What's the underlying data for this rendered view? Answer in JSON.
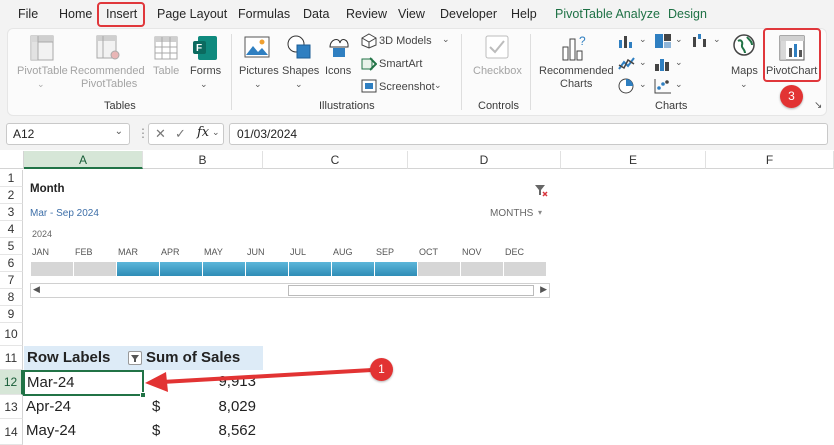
{
  "menu": {
    "tabs": [
      "File",
      "Home",
      "Insert",
      "Page Layout",
      "Formulas",
      "Data",
      "Review",
      "View",
      "Developer",
      "Help",
      "PivotTable Analyze",
      "Design"
    ]
  },
  "ribbon": {
    "tables": {
      "pivottable": "PivotTable",
      "recommended_pivot_1": "Recommended",
      "recommended_pivot_2": "PivotTables",
      "table": "Table",
      "forms": "Forms",
      "group": "Tables"
    },
    "illustrations": {
      "pictures": "Pictures",
      "shapes": "Shapes",
      "icons": "Icons",
      "models": "3D Models",
      "smartart": "SmartArt",
      "screenshot": "Screenshot",
      "group": "Illustrations"
    },
    "controls": {
      "checkbox": "Checkbox",
      "group": "Controls"
    },
    "charts": {
      "rec_1": "Recommended",
      "rec_2": "Charts",
      "maps": "Maps",
      "pivotchart": "PivotChart",
      "group": "Charts"
    }
  },
  "formula_bar": {
    "name_box": "A12",
    "fx": "fx",
    "value": "01/03/2024"
  },
  "columns": [
    "A",
    "B",
    "C",
    "D",
    "E",
    "F"
  ],
  "rows": [
    "1",
    "2",
    "3",
    "4",
    "5",
    "6",
    "7",
    "8",
    "9",
    "10",
    "11",
    "12",
    "13",
    "14"
  ],
  "timeline": {
    "title": "Month",
    "range": "Mar - Sep 2024",
    "level": "MONTHS",
    "year": "2024",
    "months": [
      "JAN",
      "FEB",
      "MAR",
      "APR",
      "MAY",
      "JUN",
      "JUL",
      "AUG",
      "SEP",
      "OCT",
      "NOV",
      "DEC"
    ],
    "selected_from_month_index": 2,
    "selected_to_month_index": 8
  },
  "pivot": {
    "header_labels": "Row Labels",
    "header_sum": "Sum of Sales",
    "rows": [
      {
        "label": "Mar-24",
        "currency": "",
        "value": "9,913"
      },
      {
        "label": "Apr-24",
        "currency": "$",
        "value": "8,029"
      },
      {
        "label": "May-24",
        "currency": "$",
        "value": "8,562"
      }
    ]
  },
  "callouts": [
    "1",
    "2",
    "3"
  ],
  "colors": {
    "accent_red": "#e23333",
    "excel_green": "#217346",
    "timeline_blue": "#3aa0c8",
    "pivot_header": "#ddebf7"
  }
}
